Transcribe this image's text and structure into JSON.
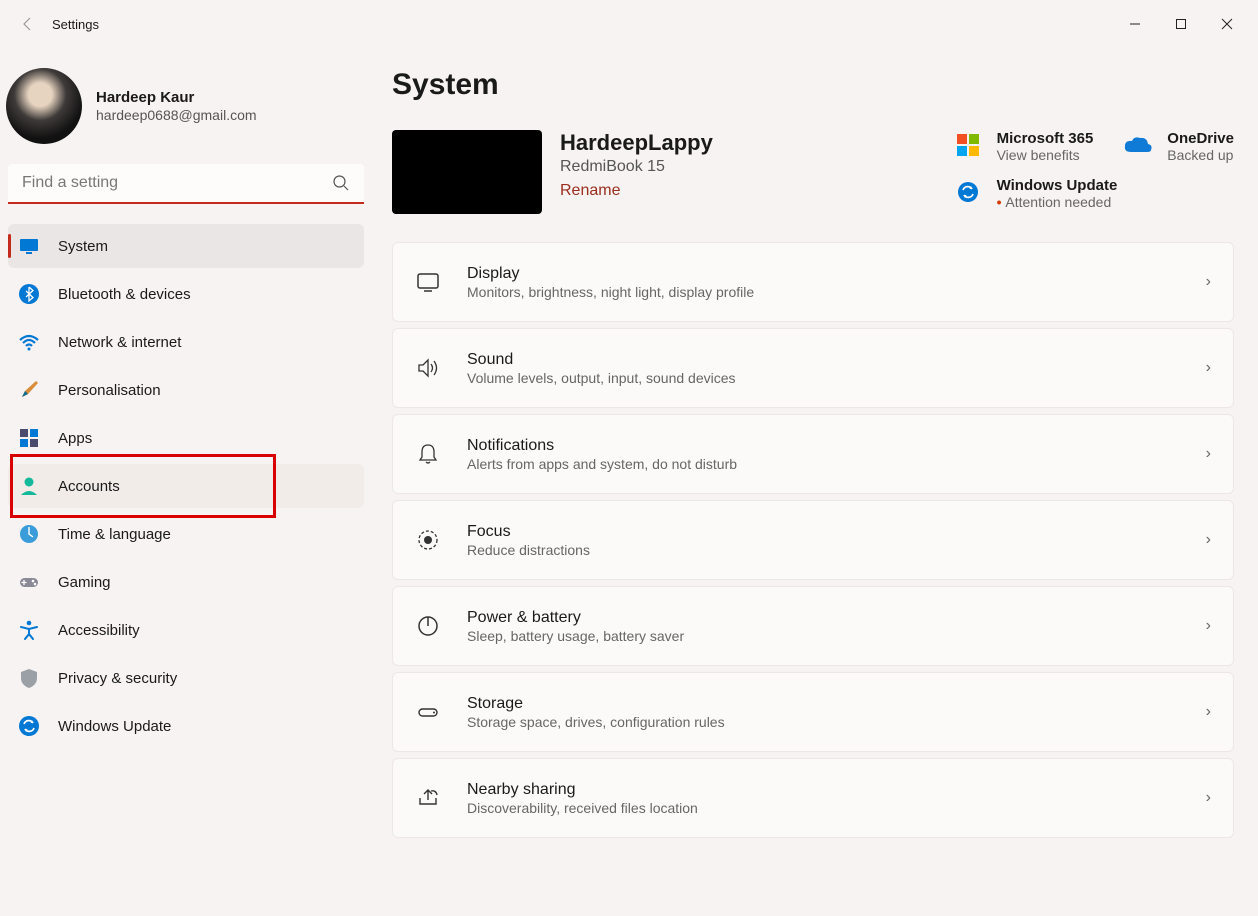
{
  "app": {
    "title": "Settings"
  },
  "profile": {
    "name": "Hardeep Kaur",
    "email": "hardeep0688@gmail.com"
  },
  "search": {
    "placeholder": "Find a setting"
  },
  "sidebar": {
    "items": [
      {
        "label": "System",
        "icon": "monitor",
        "selected": true
      },
      {
        "label": "Bluetooth & devices",
        "icon": "bluetooth",
        "selected": false
      },
      {
        "label": "Network & internet",
        "icon": "wifi",
        "selected": false
      },
      {
        "label": "Personalisation",
        "icon": "brush",
        "selected": false
      },
      {
        "label": "Apps",
        "icon": "apps",
        "selected": false
      },
      {
        "label": "Accounts",
        "icon": "person",
        "selected": false,
        "highlighted": true,
        "annotated": true
      },
      {
        "label": "Time & language",
        "icon": "clock-globe",
        "selected": false
      },
      {
        "label": "Gaming",
        "icon": "gamepad",
        "selected": false
      },
      {
        "label": "Accessibility",
        "icon": "accessibility",
        "selected": false
      },
      {
        "label": "Privacy & security",
        "icon": "shield",
        "selected": false
      },
      {
        "label": "Windows Update",
        "icon": "sync",
        "selected": false
      }
    ]
  },
  "page": {
    "title": "System",
    "device": {
      "name": "HardeepLappy",
      "model": "RedmiBook 15",
      "rename_label": "Rename"
    },
    "info_cards": [
      {
        "icon": "ms365",
        "title": "Microsoft 365",
        "sub": "View benefits",
        "attention": false
      },
      {
        "icon": "onedrive",
        "title": "OneDrive",
        "sub": "Backed up",
        "attention": false
      },
      {
        "icon": "sync",
        "title": "Windows Update",
        "sub": "Attention needed",
        "attention": true
      }
    ],
    "settings": [
      {
        "icon": "display",
        "title": "Display",
        "desc": "Monitors, brightness, night light, display profile"
      },
      {
        "icon": "sound",
        "title": "Sound",
        "desc": "Volume levels, output, input, sound devices"
      },
      {
        "icon": "bell",
        "title": "Notifications",
        "desc": "Alerts from apps and system, do not disturb"
      },
      {
        "icon": "focus",
        "title": "Focus",
        "desc": "Reduce distractions"
      },
      {
        "icon": "power",
        "title": "Power & battery",
        "desc": "Sleep, battery usage, battery saver"
      },
      {
        "icon": "storage",
        "title": "Storage",
        "desc": "Storage space, drives, configuration rules"
      },
      {
        "icon": "share",
        "title": "Nearby sharing",
        "desc": "Discoverability, received files location"
      }
    ]
  }
}
